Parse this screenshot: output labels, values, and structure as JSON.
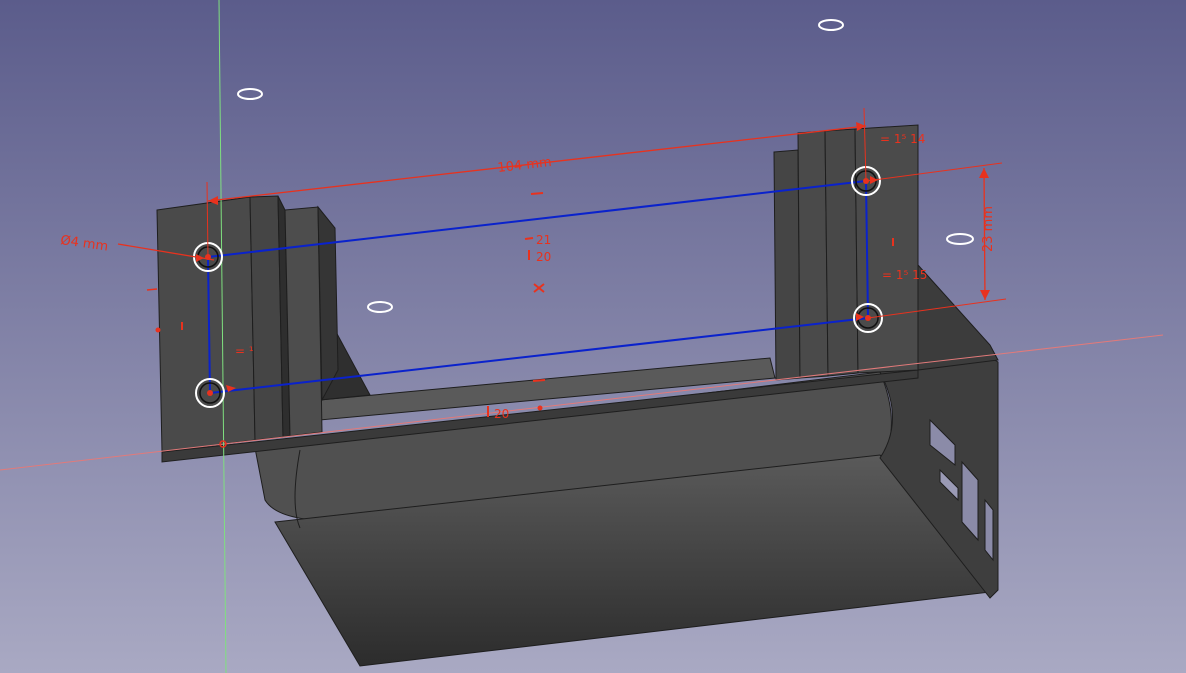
{
  "viewport": {
    "background_top": "#5b5c8b",
    "background_bottom": "#a9a9c3"
  },
  "colors": {
    "solid_face": "#474747",
    "solid_face_light": "#565656",
    "solid_dark": "#333333",
    "edge": "#1e1e1e",
    "sketch_line": "#0a22cc",
    "constraint": "#e8321e",
    "x_axis": "#e27a7a",
    "y_axis": "#7fe07f",
    "circle": "#ffffff"
  },
  "dimensions": {
    "width_label": "104 mm",
    "height_label": "23 mm",
    "diameter_label": "Ø4 mm"
  },
  "constraints": {
    "top_right_equal": "= 1⁵ 14",
    "right_equal": "= 1⁵ 15",
    "center_21": "21",
    "center_20": "20",
    "bottom_20": "20",
    "left_equal": "= ¹"
  },
  "icons": {
    "horizontal_constraint": "horizontal-constraint-icon",
    "vertical_constraint": "vertical-constraint-icon",
    "symmetry_constraint": "symmetry-constraint-icon"
  }
}
